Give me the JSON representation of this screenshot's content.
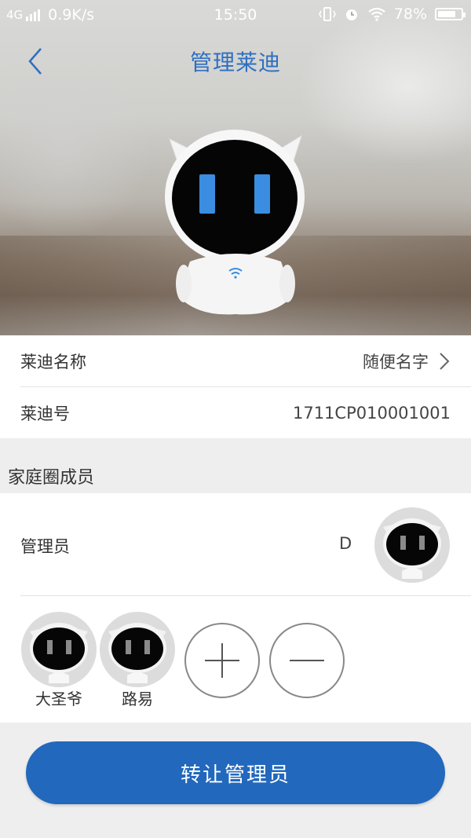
{
  "status_bar": {
    "network_type": "4G",
    "speed": "0.9K/s",
    "time": "15:50",
    "battery": "78%",
    "battery_level": 0.78
  },
  "nav": {
    "title": "管理莱迪",
    "back_icon": "chevron-left-icon"
  },
  "colors": {
    "accent": "#2f6fc0",
    "button": "#2268bd",
    "robot_eye": "#3a8de0"
  },
  "info": {
    "name_label": "莱迪名称",
    "name_value": "随便名字",
    "id_label": "莱迪号",
    "id_value": "1711CP010001001"
  },
  "family": {
    "section_title": "家庭圈成员",
    "admin_label": "管理员",
    "admin_name": "D",
    "members": [
      {
        "name": "大圣爷"
      },
      {
        "name": "路易"
      }
    ]
  },
  "actions": {
    "transfer_admin": "转让管理员",
    "add_icon": "plus-icon",
    "remove_icon": "minus-icon"
  }
}
